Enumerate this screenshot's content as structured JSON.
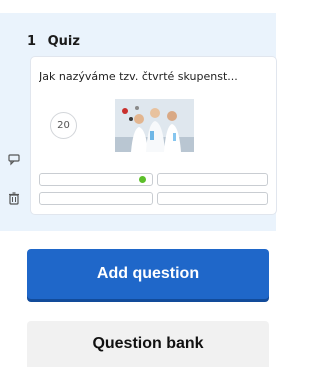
{
  "slide": {
    "number": "1",
    "type_label": "Quiz",
    "question_text": "Jak nazýváme tzv. čtvrté skupenst...",
    "timer_value": "20",
    "image_icon": "scientists-photo",
    "answers": [
      "",
      "",
      "",
      ""
    ],
    "correct_answer_index": 0,
    "correct_color": "#5cbf2a"
  },
  "side_icons": [
    "comment-icon",
    "trash-icon"
  ],
  "buttons": {
    "add_question": "Add question",
    "question_bank": "Question bank"
  },
  "colors": {
    "panel_bg": "#eaf3fc",
    "primary": "#1f67c9",
    "secondary_bg": "#f1f1f1"
  }
}
